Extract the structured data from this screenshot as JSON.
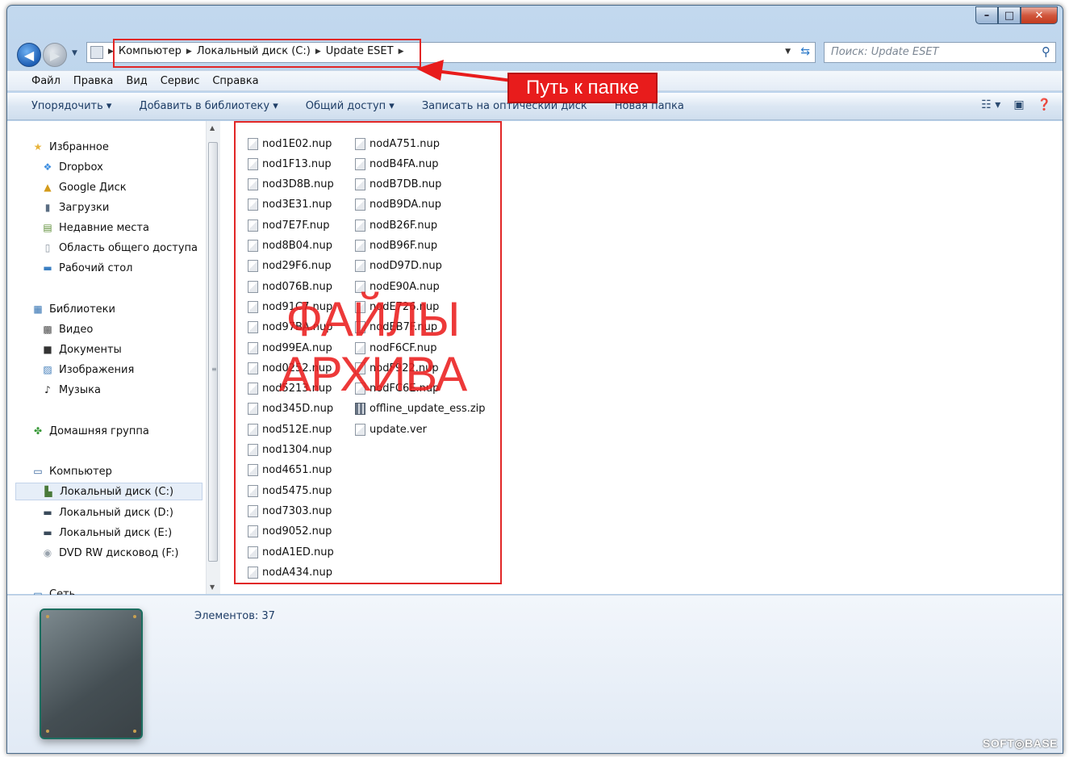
{
  "window": {
    "caption_buttons": {
      "minimize": "–",
      "maximize": "□",
      "close": "✕"
    }
  },
  "address": {
    "breadcrumbs": [
      "Компьютер",
      "Локальный диск (C:)",
      "Update ESET"
    ],
    "search_placeholder": "Поиск: Update ESET"
  },
  "menu": [
    "Файл",
    "Правка",
    "Вид",
    "Сервис",
    "Справка"
  ],
  "toolbar": {
    "organize": "Упорядочить ▾",
    "add_to_library": "Добавить в библиотеку ▾",
    "share": "Общий доступ ▾",
    "burn": "Записать на оптический диск",
    "new_folder": "Новая папка"
  },
  "sidebar": {
    "favorites": {
      "header": "Избранное",
      "items": [
        "Dropbox",
        "Google Диск",
        "Загрузки",
        "Недавние места",
        "Область общего доступа",
        "Рабочий стол"
      ]
    },
    "libraries": {
      "header": "Библиотеки",
      "items": [
        "Видео",
        "Документы",
        "Изображения",
        "Музыка"
      ]
    },
    "homegroup": "Домашняя группа",
    "computer": {
      "header": "Компьютер",
      "items": [
        "Локальный диск (C:)",
        "Локальный диск (D:)",
        "Локальный диск (E:)",
        "DVD RW дисковод (F:)"
      ],
      "selected_index": 0
    },
    "network": "Сеть"
  },
  "files": {
    "column1": [
      "nod1E02.nup",
      "nod1F13.nup",
      "nod3D8B.nup",
      "nod3E31.nup",
      "nod7E7F.nup",
      "nod8B04.nup",
      "nod29F6.nup",
      "nod076B.nup",
      "nod91C7.nup",
      "nod97BA.nup",
      "nod99EA.nup",
      "nod0252.nup",
      "nod5213.nup",
      "nod345D.nup",
      "nod512E.nup",
      "nod1304.nup",
      "nod4651.nup",
      "nod5475.nup",
      "nod7303.nup",
      "nod9052.nup",
      "nodA1ED.nup",
      "nodA434.nup"
    ],
    "column2": [
      "nodA751.nup",
      "nodB4FA.nup",
      "nodB7DB.nup",
      "nodB9DA.nup",
      "nodB26F.nup",
      "nodB96F.nup",
      "nodD97D.nup",
      "nodE90A.nup",
      "nodE726.nup",
      "nodEB7F.nup",
      "nodF6CF.nup",
      "nodF922.nup",
      "nodFC6E.nup",
      "offline_update_ess.zip",
      "update.ver"
    ],
    "zip_index_column2": 13
  },
  "details": {
    "item_count": "Элементов: 37"
  },
  "annotations": {
    "callout": "Путь к папке",
    "big_label_line1": "ФАЙЛЫ",
    "big_label_line2": "АРХИВА",
    "color": "#e12626"
  },
  "watermark": "SOFT◎BASE"
}
